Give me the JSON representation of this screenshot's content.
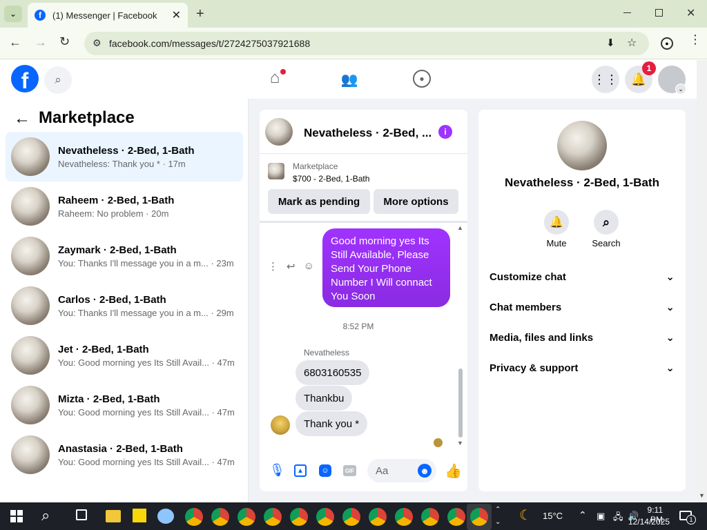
{
  "browser": {
    "tab_title": "(1) Messenger | Facebook",
    "url": "facebook.com/messages/t/2724275037921688"
  },
  "header": {
    "notification_count": "1"
  },
  "sidebar": {
    "title": "Marketplace",
    "conversations": [
      {
        "name": "Nevatheless · 2-Bed, 1-Bath",
        "preview": "Nevatheless: Thank you * · 17m",
        "active": true
      },
      {
        "name": "Raheem · 2-Bed, 1-Bath",
        "preview": "Raheem: No problem · 20m"
      },
      {
        "name": "Zaymark · 2-Bed, 1-Bath",
        "preview": "You: Thanks I'll message you in a m...",
        "time": "· 23m"
      },
      {
        "name": "Carlos · 2-Bed, 1-Bath",
        "preview": "You: Thanks I'll message you in a m...",
        "time": "· 29m"
      },
      {
        "name": "Jet · 2-Bed, 1-Bath",
        "preview": "You: Good morning yes Its Still Avail...",
        "time": "· 47m"
      },
      {
        "name": "Mizta · 2-Bed, 1-Bath",
        "preview": "You: Good morning yes Its Still Avail...",
        "time": "· 47m"
      },
      {
        "name": "Anastasia · 2-Bed, 1-Bath",
        "preview": "You: Good morning yes Its Still Avail...",
        "time": "· 47m"
      }
    ]
  },
  "chat": {
    "title": "Nevatheless · 2-Bed, ...",
    "listing_source": "Marketplace",
    "listing": "$700 - 2-Bed, 1-Bath",
    "mark_pending": "Mark as pending",
    "more_options": "More options",
    "sent_message": "Good morning yes Its Still Available, Please Send Your Phone Number I Will connact You Soon",
    "timestamp": "8:52 PM",
    "sender": "Nevatheless",
    "received": [
      "6803160535",
      "Thankbu",
      "Thank you *"
    ],
    "input_placeholder": "Aa"
  },
  "info": {
    "title": "Nevatheless · 2-Bed, 1-Bath",
    "mute": "Mute",
    "search": "Search",
    "sections": [
      "Customize chat",
      "Chat members",
      "Media, files and links",
      "Privacy & support"
    ]
  },
  "taskbar": {
    "temperature": "15°C",
    "time": "9:11 PM",
    "date": "12/14/2025",
    "notif": "1"
  },
  "colors": {
    "accent": "#0866ff",
    "sent_bubble": "#8a2be2",
    "active_row": "#ebf5ff"
  }
}
